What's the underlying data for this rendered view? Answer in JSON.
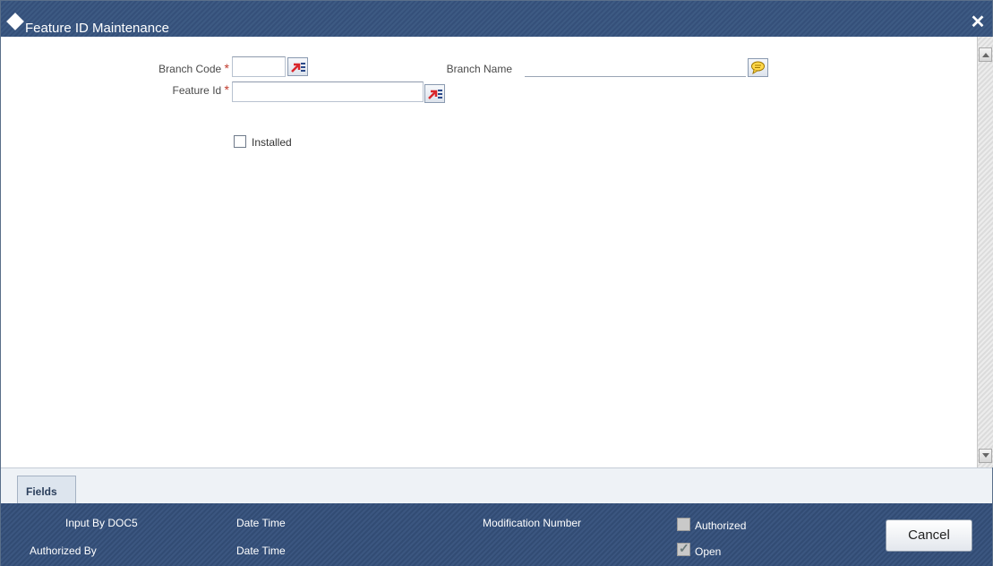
{
  "window": {
    "title": "Feature ID Maintenance",
    "close_symbol": "✕"
  },
  "form": {
    "branch_code_label": "Branch Code",
    "branch_code_value": "",
    "branch_name_label": "Branch Name",
    "branch_name_value": "",
    "feature_id_label": "Feature Id",
    "feature_id_value": "",
    "required_marker": "*",
    "installed_label": "Installed",
    "installed_checked": false
  },
  "tabs": [
    {
      "label": "Fields"
    }
  ],
  "footer": {
    "input_by": "Input By DOC5",
    "authorized_by": "Authorized By",
    "date_time_1": "Date Time",
    "date_time_2": "Date Time",
    "modification_number": "Modification Number",
    "authorized_label": "Authorized",
    "authorized_checked": false,
    "open_label": "Open",
    "open_checked": true,
    "cancel_label": "Cancel"
  },
  "colors": {
    "title_bar": "#3d5a83",
    "footer_bar": "#3b5680",
    "required_star": "#c0392b",
    "lov_icon_red": "#d9262b",
    "lov_icon_blue": "#2b4a8a",
    "comment_icon": "#e0b400"
  },
  "icons": {
    "title": "diamond-icon",
    "close": "close-icon",
    "lov": "list-of-values-icon",
    "comment": "comment-icon",
    "scroll_up": "arrow-up-icon",
    "scroll_down": "arrow-down-icon"
  }
}
